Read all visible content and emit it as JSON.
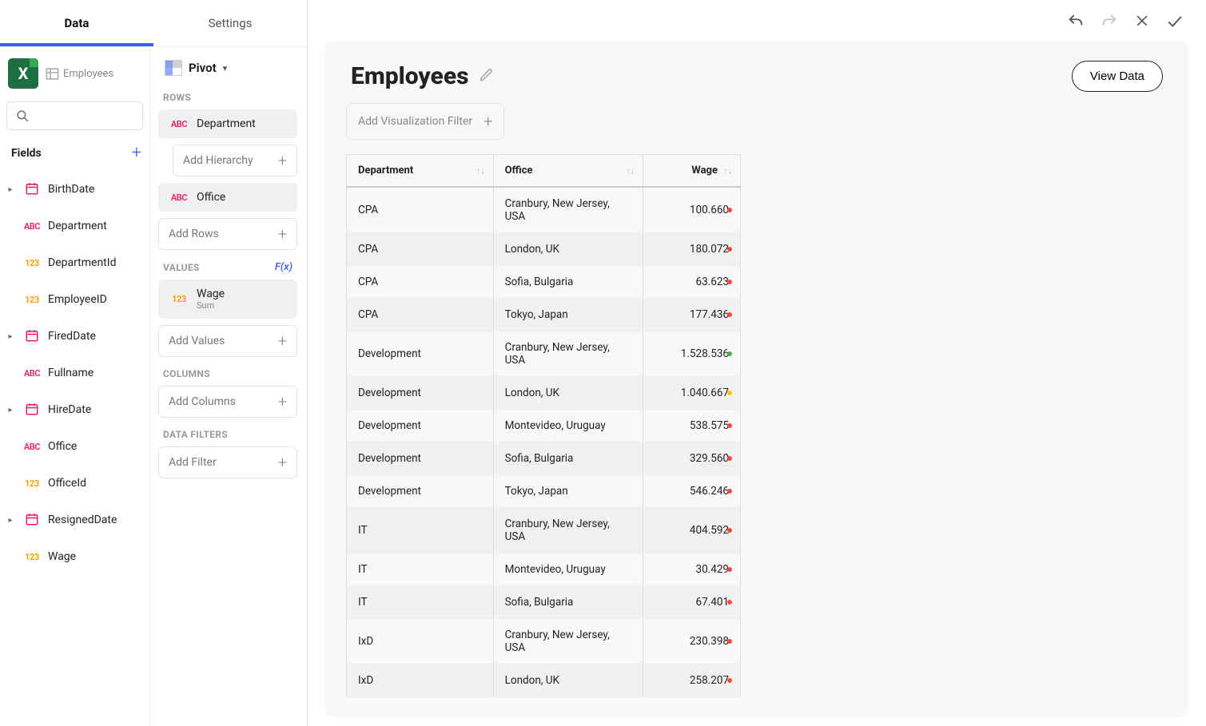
{
  "tabs": {
    "data": "Data",
    "settings": "Settings"
  },
  "source": {
    "name": "Employees"
  },
  "fields": {
    "header": "Fields",
    "items": [
      {
        "name": "BirthDate",
        "type": "date",
        "expandable": true
      },
      {
        "name": "Department",
        "type": "abc",
        "expandable": false
      },
      {
        "name": "DepartmentId",
        "type": "123",
        "expandable": false
      },
      {
        "name": "EmployeeID",
        "type": "123",
        "expandable": false
      },
      {
        "name": "FiredDate",
        "type": "date",
        "expandable": true
      },
      {
        "name": "Fullname",
        "type": "abc",
        "expandable": false
      },
      {
        "name": "HireDate",
        "type": "date",
        "expandable": true
      },
      {
        "name": "Office",
        "type": "abc",
        "expandable": false
      },
      {
        "name": "OfficeId",
        "type": "123",
        "expandable": false
      },
      {
        "name": "ResignedDate",
        "type": "date",
        "expandable": true
      },
      {
        "name": "Wage",
        "type": "123",
        "expandable": false
      }
    ]
  },
  "pivot": {
    "label": "Pivot",
    "sections": {
      "rows": "ROWS",
      "values": "VALUES",
      "columns": "COLUMNS",
      "data_filters": "DATA FILTERS"
    },
    "fx": "F(x)",
    "rows_items": [
      {
        "name": "Department",
        "type": "abc"
      },
      {
        "name": "Office",
        "type": "abc"
      }
    ],
    "add_hierarchy": "Add Hierarchy",
    "add_rows": "Add Rows",
    "values_items": [
      {
        "name": "Wage",
        "type": "123",
        "agg": "Sum"
      }
    ],
    "add_values": "Add Values",
    "add_columns": "Add Columns",
    "add_filter": "Add Filter"
  },
  "viz": {
    "title": "Employees",
    "view_data": "View Data",
    "add_filter": "Add Visualization Filter",
    "headers": [
      "Department",
      "Office",
      "Wage"
    ],
    "rows": [
      {
        "dept": "CPA",
        "office": "Cranbury, New Jersey, USA",
        "wage": "100.660",
        "dot": "red"
      },
      {
        "dept": "CPA",
        "office": "London, UK",
        "wage": "180.072",
        "dot": "red"
      },
      {
        "dept": "CPA",
        "office": "Sofia, Bulgaria",
        "wage": "63.623",
        "dot": "red"
      },
      {
        "dept": "CPA",
        "office": "Tokyo, Japan",
        "wage": "177.436",
        "dot": "red"
      },
      {
        "dept": "Development",
        "office": "Cranbury, New Jersey, USA",
        "wage": "1.528.536",
        "dot": "green"
      },
      {
        "dept": "Development",
        "office": "London, UK",
        "wage": "1.040.667",
        "dot": "yellow"
      },
      {
        "dept": "Development",
        "office": "Montevideo, Uruguay",
        "wage": "538.575",
        "dot": "red"
      },
      {
        "dept": "Development",
        "office": "Sofia, Bulgaria",
        "wage": "329.560",
        "dot": "red"
      },
      {
        "dept": "Development",
        "office": "Tokyo, Japan",
        "wage": "546.246",
        "dot": "red"
      },
      {
        "dept": "IT",
        "office": "Cranbury, New Jersey, USA",
        "wage": "404.592",
        "dot": "red"
      },
      {
        "dept": "IT",
        "office": "Montevideo, Uruguay",
        "wage": "30.429",
        "dot": "red"
      },
      {
        "dept": "IT",
        "office": "Sofia, Bulgaria",
        "wage": "67.401",
        "dot": "red"
      },
      {
        "dept": "IxD",
        "office": "Cranbury, New Jersey, USA",
        "wage": "230.398",
        "dot": "red"
      },
      {
        "dept": "IxD",
        "office": "London, UK",
        "wage": "258.207",
        "dot": "red"
      }
    ]
  }
}
